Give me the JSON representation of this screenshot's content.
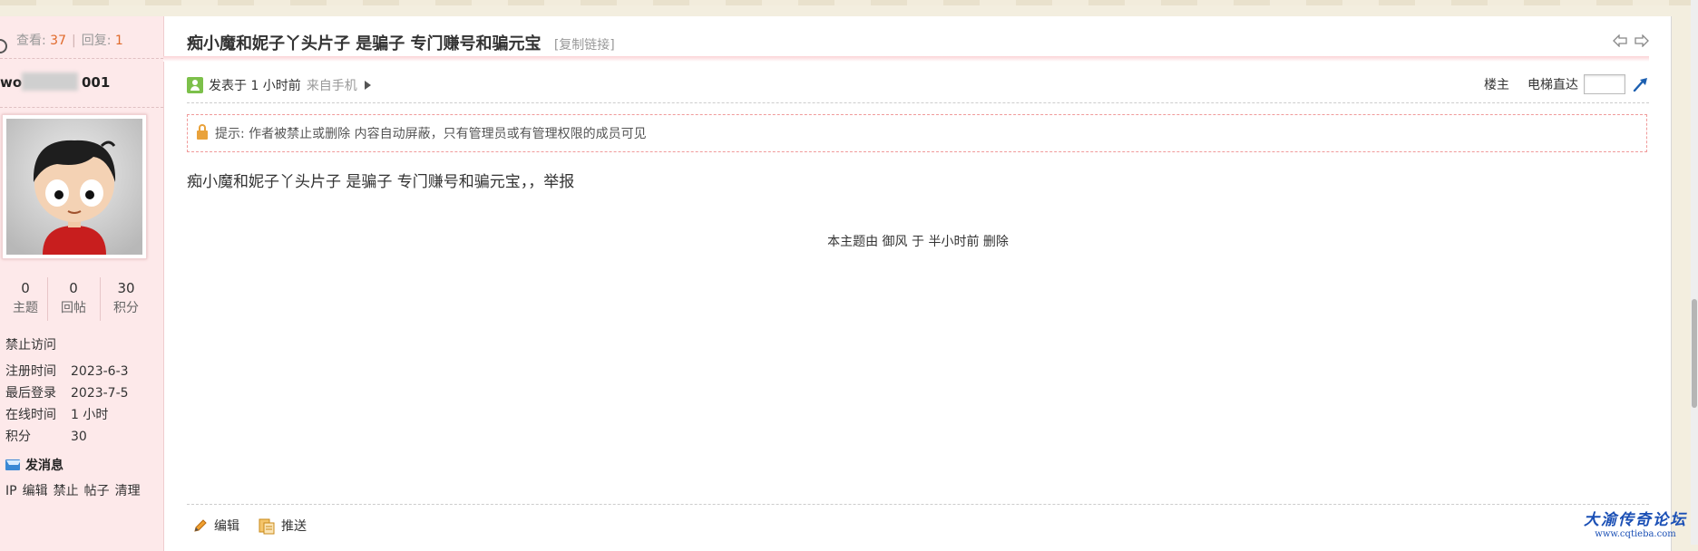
{
  "thread": {
    "views_label": "查看:",
    "views": "37",
    "replies_label": "回复:",
    "replies": "1",
    "title": "痴小魔和妮子丫头片子 是骗子 专门赚号和骗元宝",
    "copy_link": "[复制链接]"
  },
  "author": {
    "name_prefix": "wo",
    "name_suffix": "001",
    "stats": [
      {
        "value": "0",
        "label": "主题"
      },
      {
        "value": "0",
        "label": "回帖"
      },
      {
        "value": "30",
        "label": "积分"
      }
    ],
    "status": "禁止访问",
    "info": [
      {
        "key": "注册时间",
        "value": "2023-6-3"
      },
      {
        "key": "最后登录",
        "value": "2023-7-5"
      },
      {
        "key": "在线时间",
        "value": "1 小时"
      },
      {
        "key": "积分",
        "value": "30"
      }
    ],
    "send_message": "发消息",
    "admin_links": [
      "IP",
      "编辑",
      "禁止",
      "帖子",
      "清理"
    ]
  },
  "post": {
    "posted": "发表于 1 小时前",
    "from_mobile": "来自手机",
    "op_label": "楼主",
    "jump_label": "电梯直达",
    "jump_value": "",
    "notice": "提示: 作者被禁止或删除 内容自动屏蔽，只有管理员或有管理权限的成员可见",
    "body": "痴小魔和妮子丫头片子  是骗子  专门赚号和骗元宝，，举报",
    "deleted_by": "本主题由 御风 于 半小时前 删除",
    "edit_label": "编辑",
    "push_label": "推送"
  },
  "watermark": {
    "title": "大渝传奇论坛",
    "url": "www.cqtieba.com"
  },
  "colors": {
    "sidebar_bg": "#fde9ea",
    "accent_orange": "#e06a2b",
    "notice_border": "#f09a9a"
  }
}
